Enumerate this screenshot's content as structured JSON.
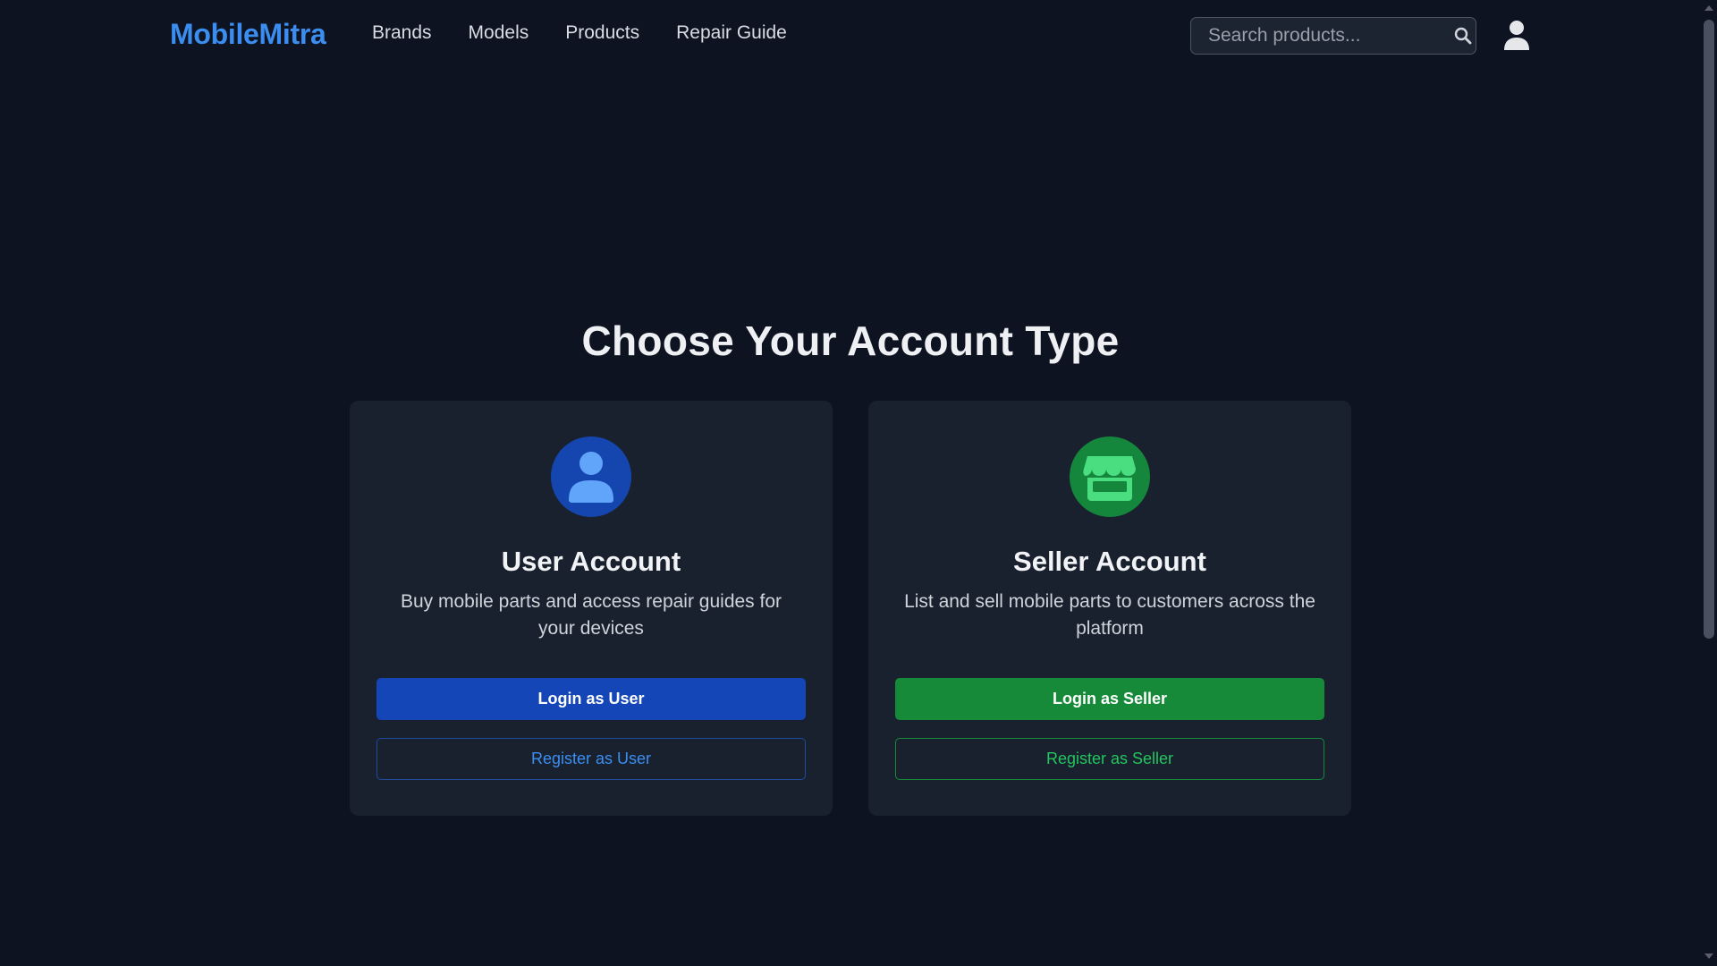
{
  "header": {
    "logo": "MobileMitra",
    "nav": [
      "Brands",
      "Models",
      "Products",
      "Repair Guide"
    ],
    "search_placeholder": "Search products...",
    "search_value": ""
  },
  "main": {
    "title": "Choose Your Account Type",
    "cards": [
      {
        "title": "User Account",
        "description": "Buy mobile parts and access repair guides for your devices",
        "primary_label": "Login as User",
        "secondary_label": "Register as User",
        "icon": "user-icon",
        "accent": "#1546b8"
      },
      {
        "title": "Seller Account",
        "description": "List and sell mobile parts to customers across the platform",
        "primary_label": "Login as Seller",
        "secondary_label": "Register as Seller",
        "icon": "store-icon",
        "accent": "#178a3a"
      }
    ]
  },
  "colors": {
    "background": "#0d1320",
    "card": "#1a212e",
    "brand": "#3b8ef0"
  }
}
